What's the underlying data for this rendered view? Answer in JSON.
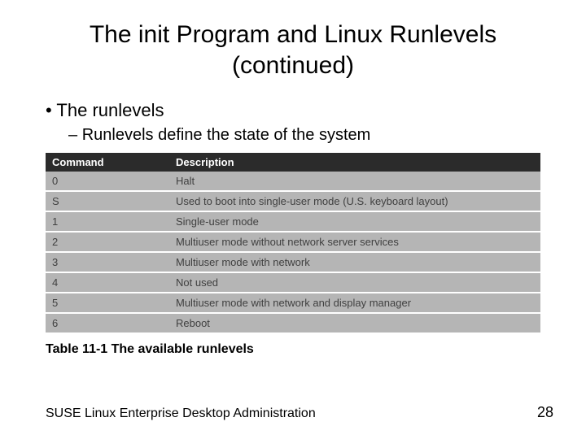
{
  "title_line1": "The init Program and Linux Runlevels",
  "title_line2": "(continued)",
  "bullets": {
    "level1": "The runlevels",
    "level2": "Runlevels define the state of the system"
  },
  "table": {
    "head_cmd": "Command",
    "head_desc": "Description",
    "rows": [
      {
        "cmd": "0",
        "desc": "Halt"
      },
      {
        "cmd": "S",
        "desc": "Used to boot into single-user mode (U.S. keyboard layout)"
      },
      {
        "cmd": "1",
        "desc": "Single-user mode"
      },
      {
        "cmd": "2",
        "desc": "Multiuser mode without network server services"
      },
      {
        "cmd": "3",
        "desc": "Multiuser mode with network"
      },
      {
        "cmd": "4",
        "desc": "Not used"
      },
      {
        "cmd": "5",
        "desc": "Multiuser mode with network and display manager"
      },
      {
        "cmd": "6",
        "desc": "Reboot"
      }
    ]
  },
  "caption": "Table 11-1 The available runlevels",
  "footer_left": "SUSE Linux Enterprise Desktop Administration",
  "page_number": "28",
  "chart_data": {
    "type": "table",
    "title": "Table 11-1 The available runlevels",
    "columns": [
      "Command",
      "Description"
    ],
    "rows": [
      [
        "0",
        "Halt"
      ],
      [
        "S",
        "Used to boot into single-user mode (U.S. keyboard layout)"
      ],
      [
        "1",
        "Single-user mode"
      ],
      [
        "2",
        "Multiuser mode without network server services"
      ],
      [
        "3",
        "Multiuser mode with network"
      ],
      [
        "4",
        "Not used"
      ],
      [
        "5",
        "Multiuser mode with network and display manager"
      ],
      [
        "6",
        "Reboot"
      ]
    ]
  }
}
